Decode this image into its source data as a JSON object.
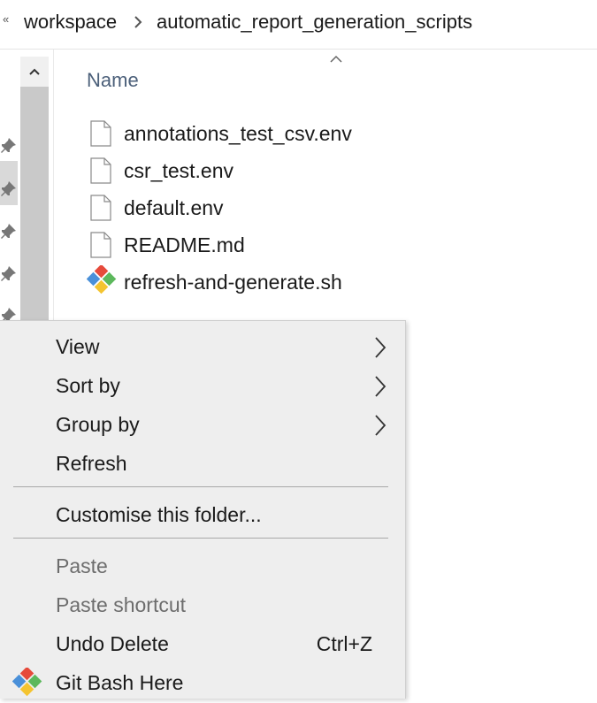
{
  "breadcrumb": {
    "overflow_glyph": "«",
    "items": [
      "workspace",
      "automatic_report_generation_scripts"
    ]
  },
  "file_list": {
    "column_header": "Name",
    "files": [
      {
        "name": "annotations_test_csv.env",
        "icon": "generic-file-icon"
      },
      {
        "name": "csr_test.env",
        "icon": "generic-file-icon"
      },
      {
        "name": "default.env",
        "icon": "generic-file-icon"
      },
      {
        "name": "README.md",
        "icon": "generic-file-icon"
      },
      {
        "name": "refresh-and-generate.sh",
        "icon": "git-bash-icon"
      }
    ]
  },
  "context_menu": {
    "items": [
      {
        "label": "View",
        "submenu": true,
        "enabled": true
      },
      {
        "label": "Sort by",
        "submenu": true,
        "enabled": true
      },
      {
        "label": "Group by",
        "submenu": true,
        "enabled": true
      },
      {
        "label": "Refresh",
        "enabled": true
      },
      {
        "label": "Customise this folder...",
        "enabled": true
      },
      {
        "label": "Paste",
        "enabled": false
      },
      {
        "label": "Paste shortcut",
        "enabled": false
      },
      {
        "label": "Undo Delete",
        "shortcut": "Ctrl+Z",
        "enabled": true
      },
      {
        "label": "Git Bash Here",
        "icon": "git-bash-icon",
        "enabled": true
      }
    ]
  },
  "colors": {
    "header_text": "#4c607a",
    "menu_background": "#eeeeee",
    "disabled_text": "#6d6d6d"
  }
}
